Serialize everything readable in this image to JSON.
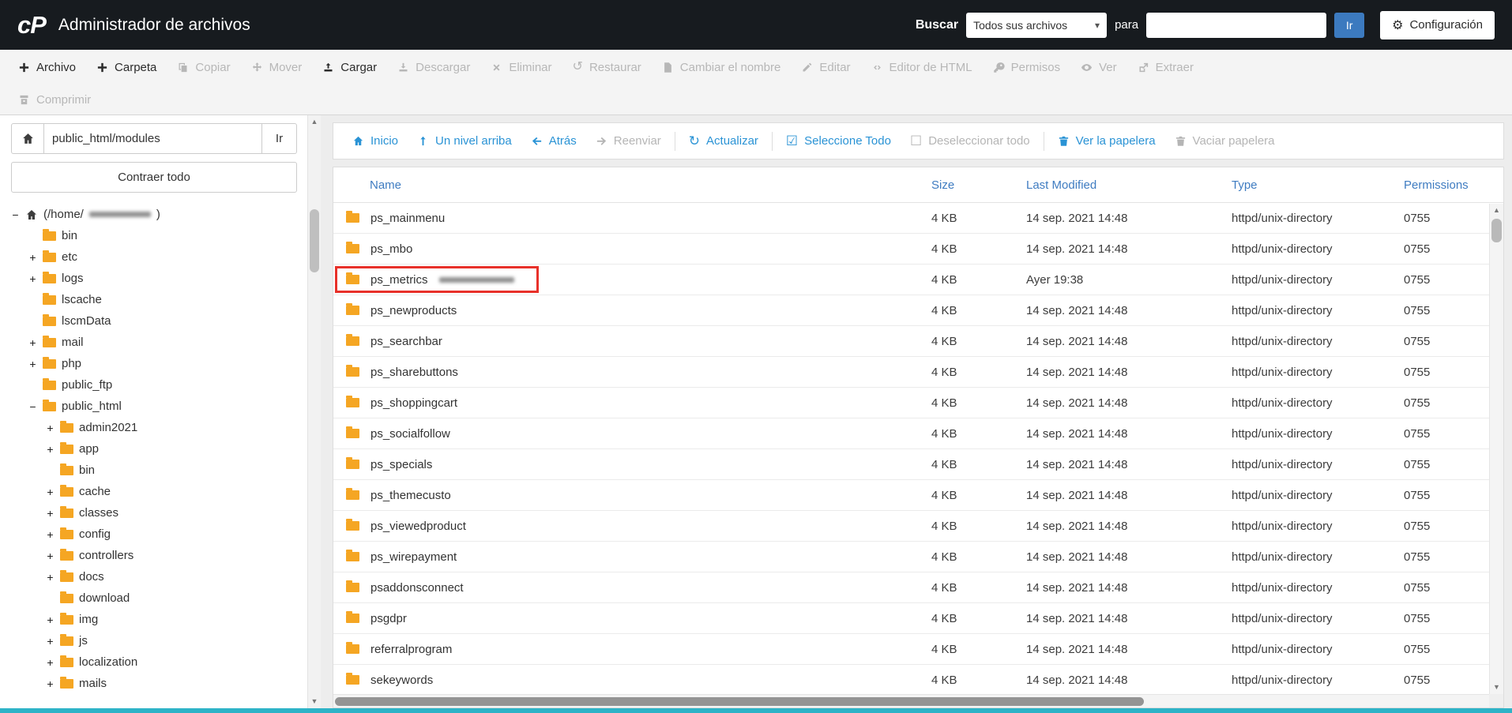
{
  "header": {
    "logo": "cP",
    "title": "Administrador de archivos",
    "search_label": "Buscar",
    "search_scope_selected": "Todos sus archivos",
    "search_connector": "para",
    "search_value": "",
    "search_go": "Ir",
    "settings_label": "Configuración"
  },
  "toolbar": {
    "row1": [
      {
        "label": "Archivo",
        "icon": "plus",
        "enabled": true
      },
      {
        "label": "Carpeta",
        "icon": "plus",
        "enabled": true
      },
      {
        "label": "Copiar",
        "icon": "copy",
        "enabled": false
      },
      {
        "label": "Mover",
        "icon": "move",
        "enabled": false
      },
      {
        "label": "Cargar",
        "icon": "upload",
        "enabled": true
      },
      {
        "label": "Descargar",
        "icon": "download",
        "enabled": false
      },
      {
        "label": "Eliminar",
        "icon": "delete",
        "enabled": false
      },
      {
        "label": "Restaurar",
        "icon": "restore",
        "enabled": false
      },
      {
        "label": "Cambiar el nombre",
        "icon": "rename",
        "enabled": false
      },
      {
        "label": "Editar",
        "icon": "edit",
        "enabled": false
      },
      {
        "label": "Editor de HTML",
        "icon": "html-edit",
        "enabled": false
      },
      {
        "label": "Permisos",
        "icon": "key",
        "enabled": false
      },
      {
        "label": "Ver",
        "icon": "eye",
        "enabled": false
      },
      {
        "label": "Extraer",
        "icon": "extract",
        "enabled": false
      }
    ],
    "row2": [
      {
        "label": "Comprimir",
        "icon": "compress",
        "enabled": false
      }
    ]
  },
  "sidebar": {
    "path_value": "public_html/modules",
    "path_go": "Ir",
    "collapse_all": "Contraer todo",
    "tree": [
      {
        "label": "(/home/",
        "suffix": ")",
        "redacted": true,
        "level": 0,
        "expander": "minus",
        "icon": "home"
      },
      {
        "label": "bin",
        "level": 1,
        "expander": "none",
        "icon": "folder"
      },
      {
        "label": "etc",
        "level": 1,
        "expander": "plus",
        "icon": "folder"
      },
      {
        "label": "logs",
        "level": 1,
        "expander": "plus",
        "icon": "folder"
      },
      {
        "label": "lscache",
        "level": 1,
        "expander": "none",
        "icon": "folder"
      },
      {
        "label": "lscmData",
        "level": 1,
        "expander": "none",
        "icon": "folder"
      },
      {
        "label": "mail",
        "level": 1,
        "expander": "plus",
        "icon": "folder"
      },
      {
        "label": "php",
        "level": 1,
        "expander": "plus",
        "icon": "folder"
      },
      {
        "label": "public_ftp",
        "level": 1,
        "expander": "none",
        "icon": "folder"
      },
      {
        "label": "public_html",
        "level": 1,
        "expander": "minus",
        "icon": "folder"
      },
      {
        "label": "admin2021",
        "level": 2,
        "expander": "plus",
        "icon": "folder"
      },
      {
        "label": "app",
        "level": 2,
        "expander": "plus",
        "icon": "folder"
      },
      {
        "label": "bin",
        "level": 2,
        "expander": "none",
        "icon": "folder"
      },
      {
        "label": "cache",
        "level": 2,
        "expander": "plus",
        "icon": "folder"
      },
      {
        "label": "classes",
        "level": 2,
        "expander": "plus",
        "icon": "folder"
      },
      {
        "label": "config",
        "level": 2,
        "expander": "plus",
        "icon": "folder"
      },
      {
        "label": "controllers",
        "level": 2,
        "expander": "plus",
        "icon": "folder"
      },
      {
        "label": "docs",
        "level": 2,
        "expander": "plus",
        "icon": "folder"
      },
      {
        "label": "download",
        "level": 2,
        "expander": "none",
        "icon": "folder"
      },
      {
        "label": "img",
        "level": 2,
        "expander": "plus",
        "icon": "folder"
      },
      {
        "label": "js",
        "level": 2,
        "expander": "plus",
        "icon": "folder"
      },
      {
        "label": "localization",
        "level": 2,
        "expander": "plus",
        "icon": "folder"
      },
      {
        "label": "mails",
        "level": 2,
        "expander": "plus",
        "icon": "folder"
      }
    ]
  },
  "main": {
    "actions": [
      {
        "label": "Inicio",
        "icon": "home",
        "enabled": true
      },
      {
        "label": "Un nivel arriba",
        "icon": "up-level",
        "enabled": true
      },
      {
        "label": "Atrás",
        "icon": "arrow-left",
        "enabled": true
      },
      {
        "label": "Reenviar",
        "icon": "arrow-right",
        "enabled": false
      },
      {
        "label": "Actualizar",
        "icon": "refresh",
        "enabled": true,
        "divider_before": true
      },
      {
        "label": "Seleccione Todo",
        "icon": "checkbox-checked",
        "enabled": true,
        "divider_before": true
      },
      {
        "label": "Deseleccionar todo",
        "icon": "checkbox-empty",
        "enabled": false
      },
      {
        "label": "Ver la papelera",
        "icon": "trash",
        "enabled": true,
        "divider_before": true
      },
      {
        "label": "Vaciar papelera",
        "icon": "trash",
        "enabled": false
      }
    ],
    "table": {
      "columns": [
        "Name",
        "Size",
        "Last Modified",
        "Type",
        "Permissions"
      ],
      "rows": [
        {
          "name": "ps_mainmenu",
          "size": "4 KB",
          "modified": "14 sep. 2021 14:48",
          "type": "httpd/unix-directory",
          "permissions": "0755"
        },
        {
          "name": "ps_mbo",
          "size": "4 KB",
          "modified": "14 sep. 2021 14:48",
          "type": "httpd/unix-directory",
          "permissions": "0755"
        },
        {
          "name": "ps_metrics",
          "redacted": true,
          "highlighted": true,
          "size": "4 KB",
          "modified": "Ayer 19:38",
          "type": "httpd/unix-directory",
          "permissions": "0755"
        },
        {
          "name": "ps_newproducts",
          "size": "4 KB",
          "modified": "14 sep. 2021 14:48",
          "type": "httpd/unix-directory",
          "permissions": "0755"
        },
        {
          "name": "ps_searchbar",
          "size": "4 KB",
          "modified": "14 sep. 2021 14:48",
          "type": "httpd/unix-directory",
          "permissions": "0755"
        },
        {
          "name": "ps_sharebuttons",
          "size": "4 KB",
          "modified": "14 sep. 2021 14:48",
          "type": "httpd/unix-directory",
          "permissions": "0755"
        },
        {
          "name": "ps_shoppingcart",
          "size": "4 KB",
          "modified": "14 sep. 2021 14:48",
          "type": "httpd/unix-directory",
          "permissions": "0755"
        },
        {
          "name": "ps_socialfollow",
          "size": "4 KB",
          "modified": "14 sep. 2021 14:48",
          "type": "httpd/unix-directory",
          "permissions": "0755"
        },
        {
          "name": "ps_specials",
          "size": "4 KB",
          "modified": "14 sep. 2021 14:48",
          "type": "httpd/unix-directory",
          "permissions": "0755"
        },
        {
          "name": "ps_themecusto",
          "size": "4 KB",
          "modified": "14 sep. 2021 14:48",
          "type": "httpd/unix-directory",
          "permissions": "0755"
        },
        {
          "name": "ps_viewedproduct",
          "size": "4 KB",
          "modified": "14 sep. 2021 14:48",
          "type": "httpd/unix-directory",
          "permissions": "0755"
        },
        {
          "name": "ps_wirepayment",
          "size": "4 KB",
          "modified": "14 sep. 2021 14:48",
          "type": "httpd/unix-directory",
          "permissions": "0755"
        },
        {
          "name": "psaddonsconnect",
          "size": "4 KB",
          "modified": "14 sep. 2021 14:48",
          "type": "httpd/unix-directory",
          "permissions": "0755"
        },
        {
          "name": "psgdpr",
          "size": "4 KB",
          "modified": "14 sep. 2021 14:48",
          "type": "httpd/unix-directory",
          "permissions": "0755"
        },
        {
          "name": "referralprogram",
          "size": "4 KB",
          "modified": "14 sep. 2021 14:48",
          "type": "httpd/unix-directory",
          "permissions": "0755"
        },
        {
          "name": "sekeywords",
          "size": "4 KB",
          "modified": "14 sep. 2021 14:48",
          "type": "httpd/unix-directory",
          "permissions": "0755"
        }
      ]
    }
  },
  "colors": {
    "topbar_bg": "#171b1f",
    "accent_blue": "#2a93d5",
    "table_header_blue": "#3f7cc1",
    "folder_orange": "#f5a623",
    "highlight_red": "#e8312a",
    "go_button_blue": "#3c7abf",
    "footer_teal": "#2eb3c7"
  }
}
